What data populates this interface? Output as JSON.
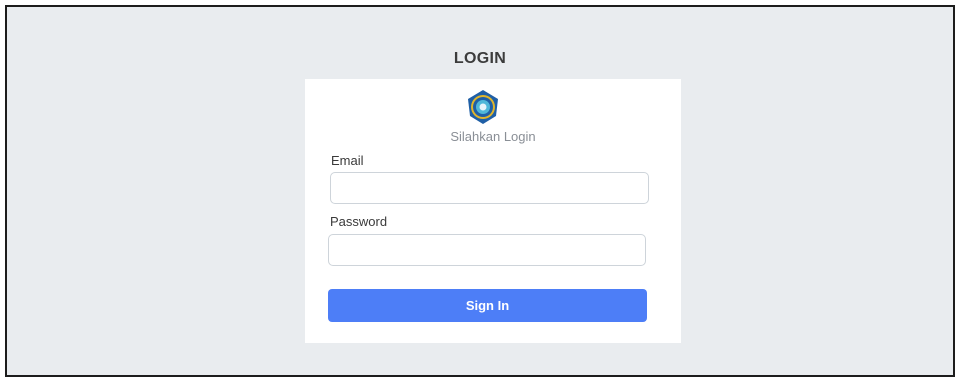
{
  "page": {
    "title": "LOGIN"
  },
  "card": {
    "logo_icon": "seal-logo-icon",
    "subtitle": "Silahkan Login"
  },
  "form": {
    "email_label": "Email",
    "email_value": "",
    "password_label": "Password",
    "password_value": "",
    "submit_label": "Sign In"
  },
  "colors": {
    "background": "#e9ecef",
    "card": "#ffffff",
    "button": "#4d7ef7",
    "logo_outer": "#1f5fa6",
    "logo_inner": "#4fb7d9"
  }
}
